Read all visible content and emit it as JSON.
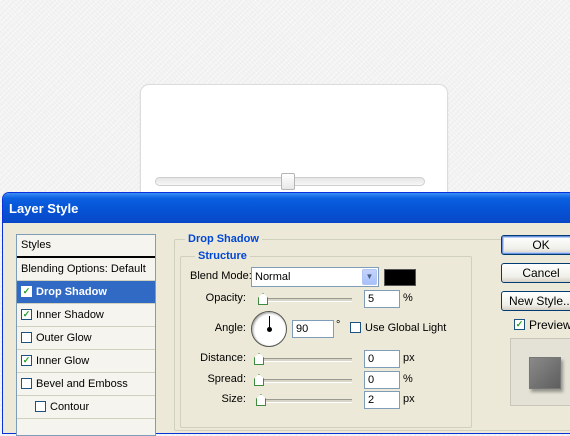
{
  "dialog": {
    "title": "Layer Style",
    "styles_list": {
      "header": "Styles",
      "items": [
        {
          "label": "Blending Options: Default",
          "checkbox": false,
          "checked": false,
          "selected": false
        },
        {
          "label": "Drop Shadow",
          "checkbox": true,
          "checked": true,
          "selected": true
        },
        {
          "label": "Inner Shadow",
          "checkbox": true,
          "checked": true,
          "selected": false
        },
        {
          "label": "Outer Glow",
          "checkbox": true,
          "checked": false,
          "selected": false
        },
        {
          "label": "Inner Glow",
          "checkbox": true,
          "checked": true,
          "selected": false
        },
        {
          "label": "Bevel and Emboss",
          "checkbox": true,
          "checked": false,
          "selected": false
        },
        {
          "label": "Contour",
          "checkbox": true,
          "checked": false,
          "selected": false,
          "indent": true
        }
      ]
    },
    "drop_shadow": {
      "group_title": "Drop Shadow",
      "structure_title": "Structure",
      "blend_mode_label": "Blend Mode:",
      "blend_mode_value": "Normal",
      "shadow_color": "#000000",
      "opacity_label": "Opacity:",
      "opacity_value": "5",
      "opacity_unit": "%",
      "angle_label": "Angle:",
      "angle_value": "90",
      "angle_unit": "°",
      "use_global_light_label": "Use Global Light",
      "use_global_light_checked": false,
      "distance_label": "Distance:",
      "distance_value": "0",
      "distance_unit": "px",
      "spread_label": "Spread:",
      "spread_value": "0",
      "spread_unit": "%",
      "size_label": "Size:",
      "size_value": "2",
      "size_unit": "px"
    },
    "buttons": {
      "ok": "OK",
      "cancel": "Cancel",
      "new_style": "New Style..."
    },
    "preview": {
      "label": "Preview",
      "checked": true
    }
  },
  "background_card": {
    "slider_level": 0.49
  },
  "colors": {
    "title_bar": "#0652d4",
    "selection": "#316ac5",
    "group_title": "#0046d5",
    "dialog_bg": "#ece9d8"
  }
}
